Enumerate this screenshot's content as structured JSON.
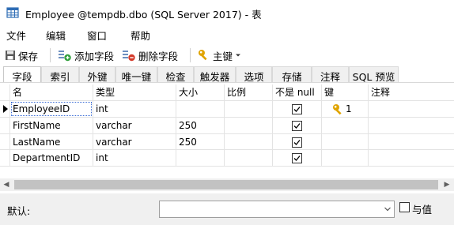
{
  "window": {
    "title": "Employee @tempdb.dbo (SQL Server 2017) - 表"
  },
  "menu": {
    "file": "文件",
    "edit": "编辑",
    "window": "窗口",
    "help": "帮助"
  },
  "toolbar": {
    "save": "保存",
    "add_field": "添加字段",
    "delete_field": "删除字段",
    "primary_key": "主键"
  },
  "tabs": [
    "字段",
    "索引",
    "外键",
    "唯一键",
    "检查",
    "触发器",
    "选项",
    "存储",
    "注释",
    "SQL 预览"
  ],
  "active_tab": "字段",
  "columns": {
    "name": "名",
    "type": "类型",
    "size": "大小",
    "scale": "比例",
    "not_null": "不是 null",
    "key": "键",
    "comment": "注释"
  },
  "rows": [
    {
      "name": "EmployeeID",
      "type": "int",
      "size": "",
      "scale": "",
      "not_null": true,
      "key": "1",
      "comment": ""
    },
    {
      "name": "FirstName",
      "type": "varchar",
      "size": "250",
      "scale": "",
      "not_null": true,
      "key": "",
      "comment": ""
    },
    {
      "name": "LastName",
      "type": "varchar",
      "size": "250",
      "scale": "",
      "not_null": true,
      "key": "",
      "comment": ""
    },
    {
      "name": "DepartmentID",
      "type": "int",
      "size": "",
      "scale": "",
      "not_null": true,
      "key": "",
      "comment": ""
    }
  ],
  "footer": {
    "default_label": "默认:",
    "default_value": "",
    "with_value_label": "与值",
    "with_value_checked": false
  },
  "colors": {
    "key_icon": "#e0a400",
    "add_icon": "#2e9e3a",
    "delete_icon": "#d43a2a",
    "selection_border": "#3a6cd6"
  },
  "icons": {
    "app": "table-grid-icon",
    "save": "save-disk-icon",
    "add_field": "add-field-icon",
    "delete_field": "delete-field-icon",
    "primary_key": "key-icon"
  }
}
